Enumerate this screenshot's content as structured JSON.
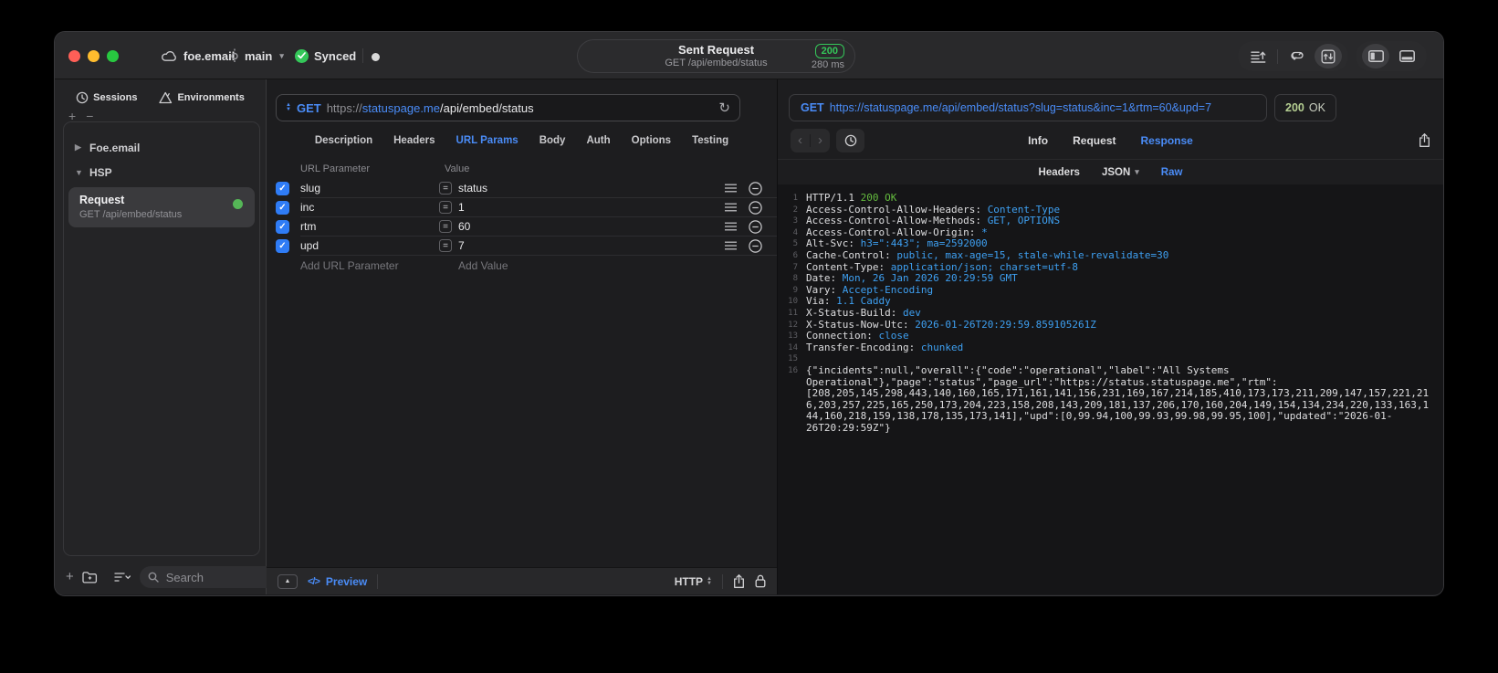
{
  "titlebar": {
    "project": "foe.email",
    "branch": "main",
    "sync_status": "Synced",
    "center": {
      "title": "Sent Request",
      "subtitle": "GET /api/embed/status",
      "status_code": "200",
      "duration": "280 ms"
    }
  },
  "sidebar": {
    "tabs": [
      {
        "label": "Sessions",
        "icon": "history-clock-icon"
      },
      {
        "label": "Environments",
        "icon": "environments-icon"
      }
    ],
    "tree": [
      {
        "label": "Foe.email",
        "state": "collapsed"
      },
      {
        "label": "HSP",
        "state": "expanded"
      }
    ],
    "selected_request": {
      "name": "Request",
      "subtitle": "GET /api/embed/status"
    },
    "search_placeholder": "Search"
  },
  "request_editor": {
    "method": "GET",
    "url_scheme": "https://",
    "url_host": "statuspage.me",
    "url_path": "/api/embed/status",
    "tabs": [
      "Description",
      "Headers",
      "URL Params",
      "Body",
      "Auth",
      "Options",
      "Testing"
    ],
    "active_tab": "URL Params",
    "params_table": {
      "columns": [
        "URL Parameter",
        "Value"
      ],
      "rows": [
        {
          "enabled": true,
          "name": "slug",
          "value": "status"
        },
        {
          "enabled": true,
          "name": "inc",
          "value": "1"
        },
        {
          "enabled": true,
          "name": "rtm",
          "value": "60"
        },
        {
          "enabled": true,
          "name": "upd",
          "value": "7"
        }
      ],
      "add_name_placeholder": "Add URL Parameter",
      "add_value_placeholder": "Add Value"
    },
    "footer": {
      "preview_label": "Preview",
      "code_glyph": "</>",
      "protocol": "HTTP"
    }
  },
  "response_viewer": {
    "method": "GET",
    "url": "https://statuspage.me/api/embed/status?slug=status&inc=1&rtm=60&upd=7",
    "status_code": "200",
    "status_text": "OK",
    "tabs": [
      "Info",
      "Request",
      "Response"
    ],
    "active_tab": "Response",
    "subtabs": [
      "Headers",
      "JSON",
      "Raw"
    ],
    "active_subtab": "Raw",
    "status_line": {
      "protocol": "HTTP/1.1",
      "status": "200 OK"
    },
    "headers": [
      {
        "name": "Access-Control-Allow-Headers",
        "value": "Content-Type"
      },
      {
        "name": "Access-Control-Allow-Methods",
        "value": "GET, OPTIONS"
      },
      {
        "name": "Access-Control-Allow-Origin",
        "value": "*"
      },
      {
        "name": "Alt-Svc",
        "value": "h3=\":443\"; ma=2592000"
      },
      {
        "name": "Cache-Control",
        "value": "public, max-age=15, stale-while-revalidate=30"
      },
      {
        "name": "Content-Type",
        "value": "application/json; charset=utf-8"
      },
      {
        "name": "Date",
        "value": "Mon, 26 Jan 2026 20:29:59 GMT"
      },
      {
        "name": "Vary",
        "value": "Accept-Encoding"
      },
      {
        "name": "Via",
        "value": "1.1 Caddy"
      },
      {
        "name": "X-Status-Build",
        "value": "dev"
      },
      {
        "name": "X-Status-Now-Utc",
        "value": "2026-01-26T20:29:59.859105261Z"
      },
      {
        "name": "Connection",
        "value": "close"
      },
      {
        "name": "Transfer-Encoding",
        "value": "chunked"
      }
    ],
    "body": "{\"incidents\":null,\"overall\":{\"code\":\"operational\",\"label\":\"All Systems Operational\"},\"page\":\"status\",\"page_url\":\"https://status.statuspage.me\",\"rtm\":[208,205,145,298,443,140,160,165,171,161,141,156,231,169,167,214,185,410,173,173,211,209,147,157,221,216,203,257,225,165,250,173,204,223,158,208,143,209,181,137,206,170,160,204,149,154,134,234,220,133,163,144,160,218,159,138,178,135,173,141],\"upd\":[0,99.94,100,99.93,99.98,99.95,100],\"updated\":\"2026-01-26T20:29:59Z\"}"
  },
  "colors": {
    "accent_blue": "#4a8cf7",
    "sync_green": "#34c759",
    "badge_green": "#34c759",
    "checkbox_blue": "#2f7cf6",
    "response_value_blue": "#3ea0f2",
    "response_status_green": "#65bd3f",
    "status_chip_green": "#b5cf92",
    "traffic_red": "#ff5f57",
    "traffic_yellow": "#febc2e",
    "traffic_green": "#28c840"
  }
}
